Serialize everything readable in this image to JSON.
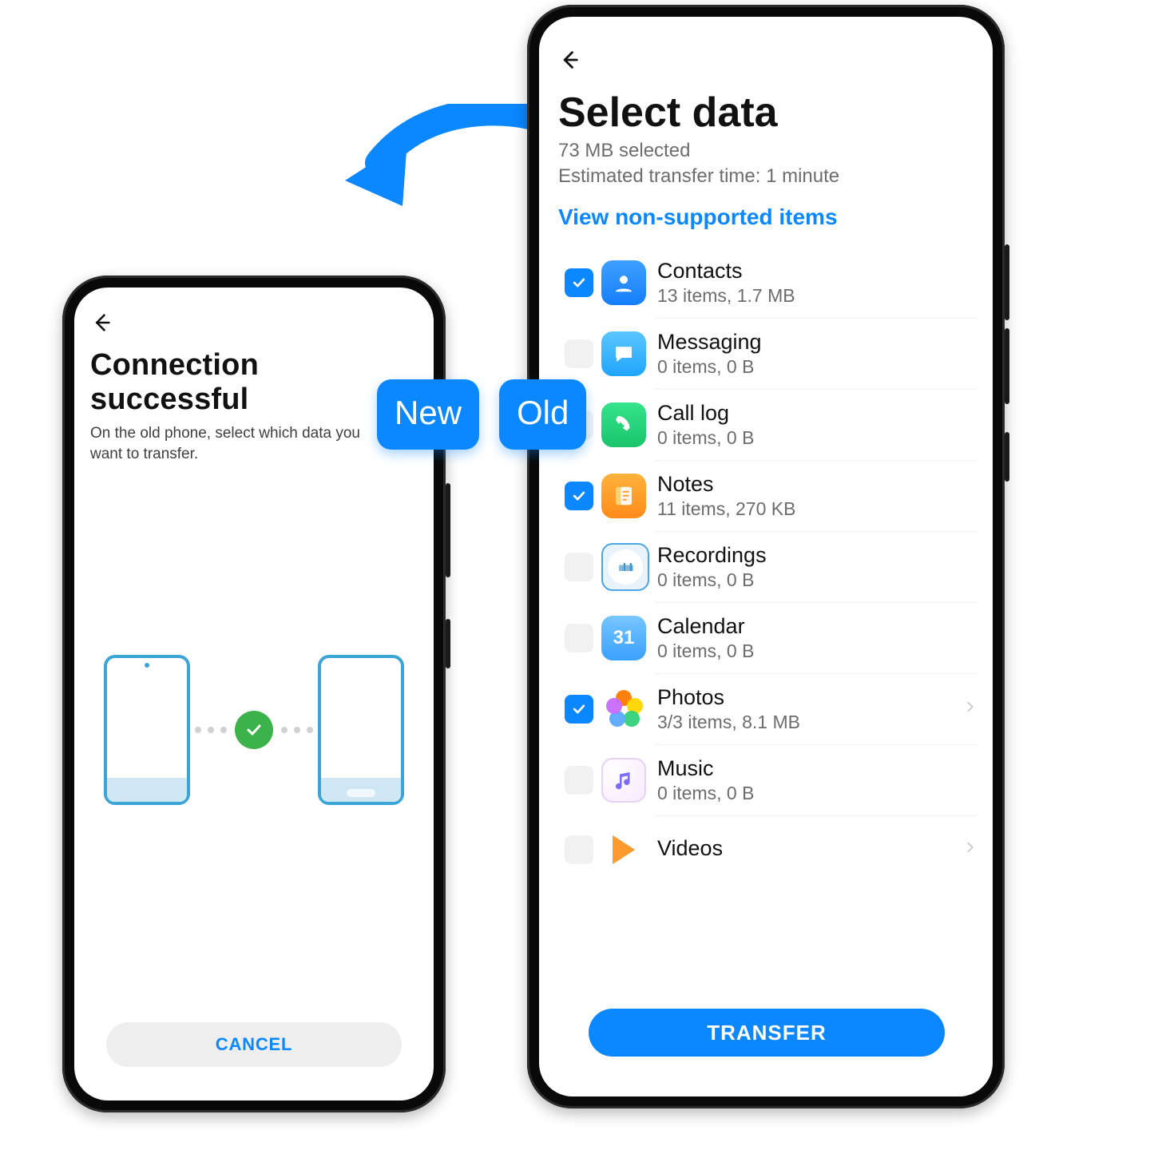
{
  "transfer_direction": "old_to_new",
  "badge": {
    "new": "New",
    "old": "Old"
  },
  "new_phone": {
    "title": "Connection successful",
    "subtitle": "On the old phone, select which data you want to transfer.",
    "cancel": "CANCEL"
  },
  "old_phone": {
    "title": "Select data",
    "selected_summary": "73 MB selected",
    "estimate": "Estimated transfer time: 1 minute",
    "non_supported": "View non-supported items",
    "transfer": "TRANSFER",
    "items": [
      {
        "icon": "contacts-icon",
        "title": "Contacts",
        "sub": "13 items, 1.7 MB",
        "checked": true,
        "has_chevron": false
      },
      {
        "icon": "messaging-icon",
        "title": "Messaging",
        "sub": "0 items, 0 B",
        "checked": false,
        "has_chevron": false
      },
      {
        "icon": "calllog-icon",
        "title": "Call log",
        "sub": "0 items, 0 B",
        "checked": false,
        "has_chevron": false
      },
      {
        "icon": "notes-icon",
        "title": "Notes",
        "sub": "11 items, 270 KB",
        "checked": true,
        "has_chevron": false
      },
      {
        "icon": "recordings-icon",
        "title": "Recordings",
        "sub": "0 items, 0 B",
        "checked": false,
        "has_chevron": false
      },
      {
        "icon": "calendar-icon",
        "title": "Calendar",
        "sub": "0 items, 0 B",
        "checked": false,
        "has_chevron": false
      },
      {
        "icon": "photos-icon",
        "title": "Photos",
        "sub": "3/3 items, 8.1 MB",
        "checked": true,
        "has_chevron": true
      },
      {
        "icon": "music-icon",
        "title": "Music",
        "sub": "0 items, 0 B",
        "checked": false,
        "has_chevron": false
      },
      {
        "icon": "videos-icon",
        "title": "Videos",
        "sub": "",
        "checked": false,
        "has_chevron": true
      }
    ]
  },
  "calendar_day": "31"
}
